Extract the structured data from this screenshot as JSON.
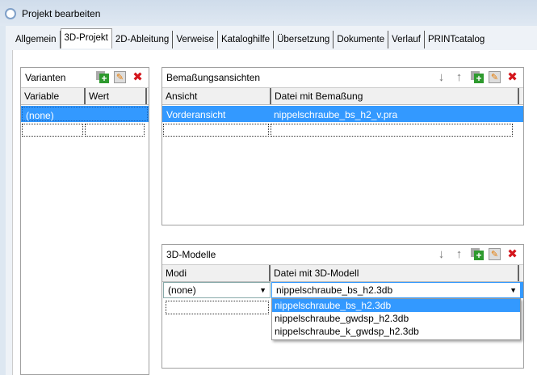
{
  "window": {
    "title": "Projekt bearbeiten"
  },
  "tabs": [
    {
      "label": "Allgemein"
    },
    {
      "label": "3D-Projekt",
      "active": true
    },
    {
      "label": "2D-Ableitung"
    },
    {
      "label": "Verweise"
    },
    {
      "label": "Kataloghilfe"
    },
    {
      "label": "Übersetzung"
    },
    {
      "label": "Dokumente"
    },
    {
      "label": "Verlauf"
    },
    {
      "label": "PRINTcatalog"
    }
  ],
  "varianten": {
    "title": "Varianten",
    "columns": [
      "Variable",
      "Wert"
    ],
    "rows": [
      [
        "(none)",
        ""
      ]
    ]
  },
  "bemassung": {
    "title": "Bemaßungsansichten",
    "columns": [
      "Ansicht",
      "Datei mit Bemaßung"
    ],
    "rows": [
      [
        "Vorderansicht",
        "nippelschraube_bs_h2_v.pra"
      ]
    ]
  },
  "modelle": {
    "title": "3D-Modelle",
    "columns": [
      "Modi",
      "Datei mit 3D-Modell"
    ],
    "modi_value": "(none)",
    "datei_value": "nippelschraube_bs_h2.3db",
    "options": [
      "nippelschraube_bs_h2.3db",
      "nippelschraube_gwdsp_h2.3db",
      "nippelschraube_k_gwdsp_h2.3db"
    ]
  },
  "icons": {
    "down": "↓",
    "up": "↑",
    "edit": "✎",
    "delete": "✖",
    "dropdown": "▼"
  }
}
